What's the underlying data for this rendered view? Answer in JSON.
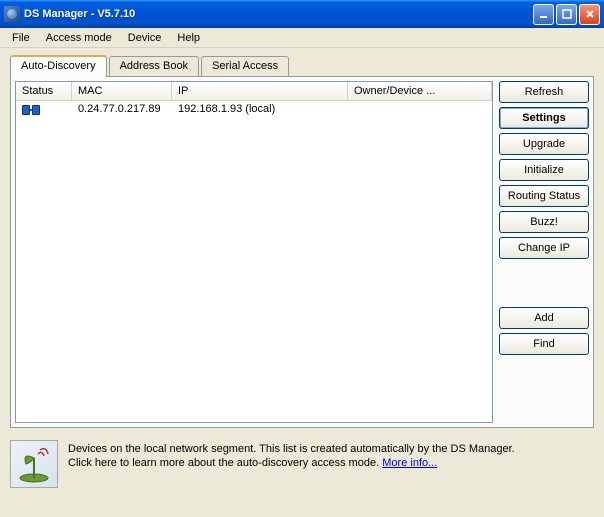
{
  "window": {
    "title": "DS Manager - V5.7.10"
  },
  "menu": {
    "file": "File",
    "access": "Access mode",
    "device": "Device",
    "help": "Help"
  },
  "tabs": {
    "auto": "Auto-Discovery",
    "address": "Address Book",
    "serial": "Serial Access"
  },
  "columns": {
    "status": "Status",
    "mac": "MAC",
    "ip": "IP",
    "owner": "Owner/Device ..."
  },
  "rows": [
    {
      "mac": "0.24.77.0.217.89",
      "ip": "192.168.1.93 (local)",
      "owner": ""
    }
  ],
  "buttons": {
    "refresh": "Refresh",
    "settings": "Settings",
    "upgrade": "Upgrade",
    "initialize": "Initialize",
    "routing": "Routing Status",
    "buzz": "Buzz!",
    "changeip": "Change IP",
    "add": "Add",
    "find": "Find"
  },
  "footer": {
    "line1": "Devices on the local network segment. This list is created automatically by the DS Manager.",
    "line2": "Click here to learn more about the auto-discovery access mode. ",
    "link": "More info..."
  }
}
